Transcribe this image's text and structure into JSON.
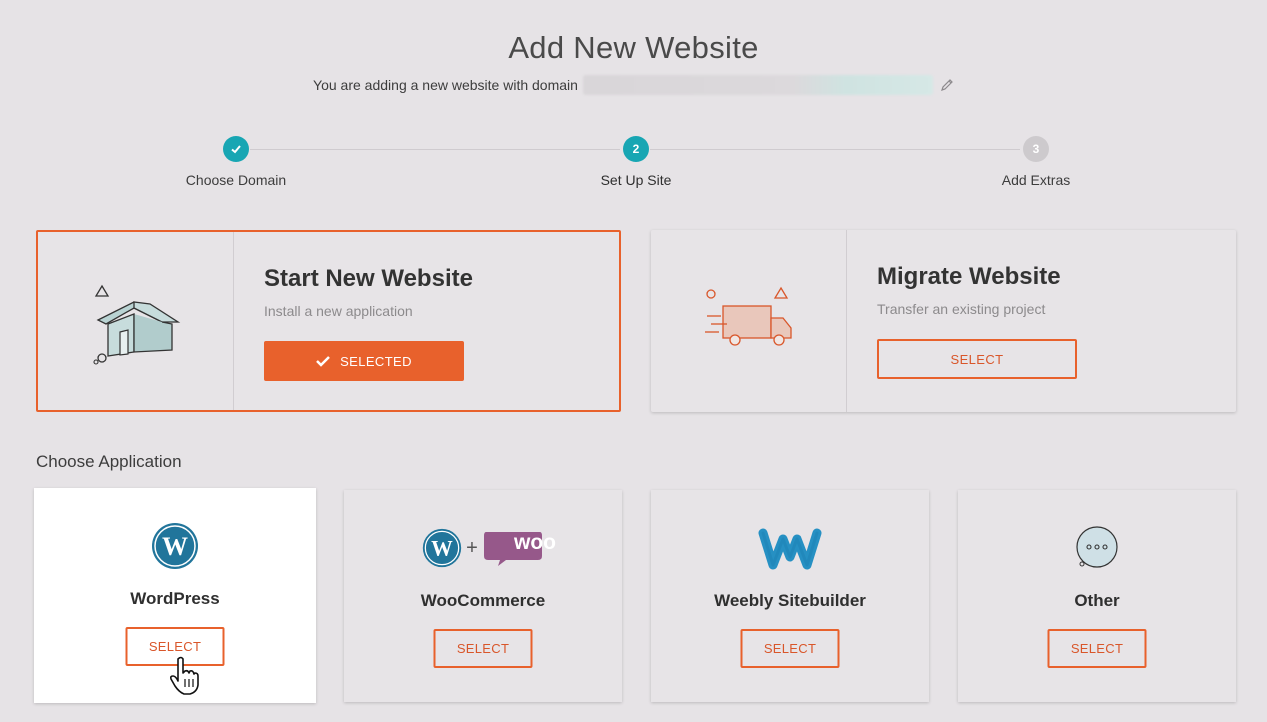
{
  "header": {
    "title": "Add New Website",
    "subtitle": "You are adding a new website with domain",
    "domain_icon": "pencil-icon"
  },
  "stepper": {
    "steps": [
      {
        "label": "Choose Domain",
        "status": "done"
      },
      {
        "label": "Set Up Site",
        "number": "2",
        "status": "active"
      },
      {
        "label": "Add Extras",
        "number": "3",
        "status": "pending"
      }
    ]
  },
  "website_types": [
    {
      "title": "Start New Website",
      "description": "Install a new application",
      "button_label": "SELECTED",
      "selected": true,
      "icon": "house-icon"
    },
    {
      "title": "Migrate Website",
      "description": "Transfer an existing project",
      "button_label": "SELECT",
      "selected": false,
      "icon": "truck-icon"
    }
  ],
  "applications_label": "Choose Application",
  "applications": [
    {
      "name": "WordPress",
      "button_label": "SELECT",
      "icon": "wordpress-icon"
    },
    {
      "name": "WooCommerce",
      "button_label": "SELECT",
      "icon": "woocommerce-icon"
    },
    {
      "name": "Weebly Sitebuilder",
      "button_label": "SELECT",
      "icon": "weebly-icon"
    },
    {
      "name": "Other",
      "button_label": "SELECT",
      "icon": "other-dots-icon"
    }
  ],
  "plus_sign": "+",
  "woo_text": "woo",
  "colors": {
    "accent": "#e8612c",
    "teal": "#18a6b3",
    "background": "#e6e3e6",
    "wordpress_blue": "#21759b",
    "woo_purple": "#96588a"
  }
}
